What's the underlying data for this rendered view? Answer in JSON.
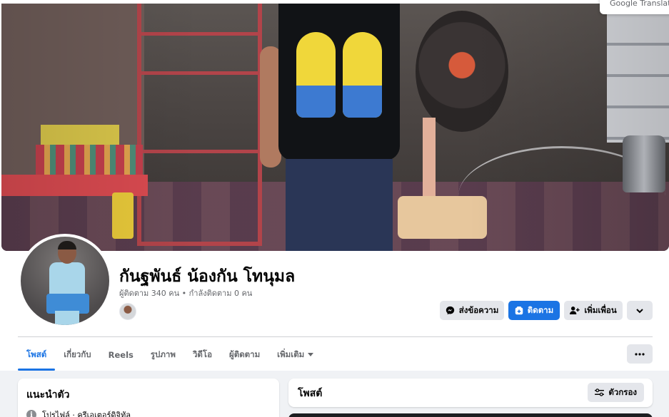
{
  "translate_chip": {
    "text": "Google Translate"
  },
  "profile": {
    "name": "กันฐพันธ์ น้องกัน โทนุมล",
    "stats": "ผู้ติดตาม 340 คน • กำลังติดตาม 0 คน"
  },
  "actions": {
    "message": "ส่งข้อความ",
    "follow": "ติดตาม",
    "add_friend": "เพิ่มเพื่อน"
  },
  "tabs": [
    {
      "label": "โพสต์",
      "active": true
    },
    {
      "label": "เกี่ยวกับ"
    },
    {
      "label": "Reels"
    },
    {
      "label": "รูปภาพ"
    },
    {
      "label": "วิดีโอ"
    },
    {
      "label": "ผู้ติดตาม"
    },
    {
      "label": "เพิ่มเติม"
    }
  ],
  "intro": {
    "title": "แนะนำตัว",
    "row": "โปรไฟล์ · ครีเอเตอร์ดิจิทัล"
  },
  "posts": {
    "title": "โพสต์",
    "filter": "ตัวกรอง"
  },
  "colors": {
    "accent": "#1b74e4",
    "button_gray": "#e4e6eb",
    "muted_text": "#65676b",
    "page_bg": "#f0f2f5"
  },
  "icons": [
    "messenger-icon",
    "follow-icon",
    "add-friend-icon",
    "chevron-down-icon",
    "more-dots-icon",
    "filter-icon",
    "info-icon",
    "caret-down-icon"
  ]
}
